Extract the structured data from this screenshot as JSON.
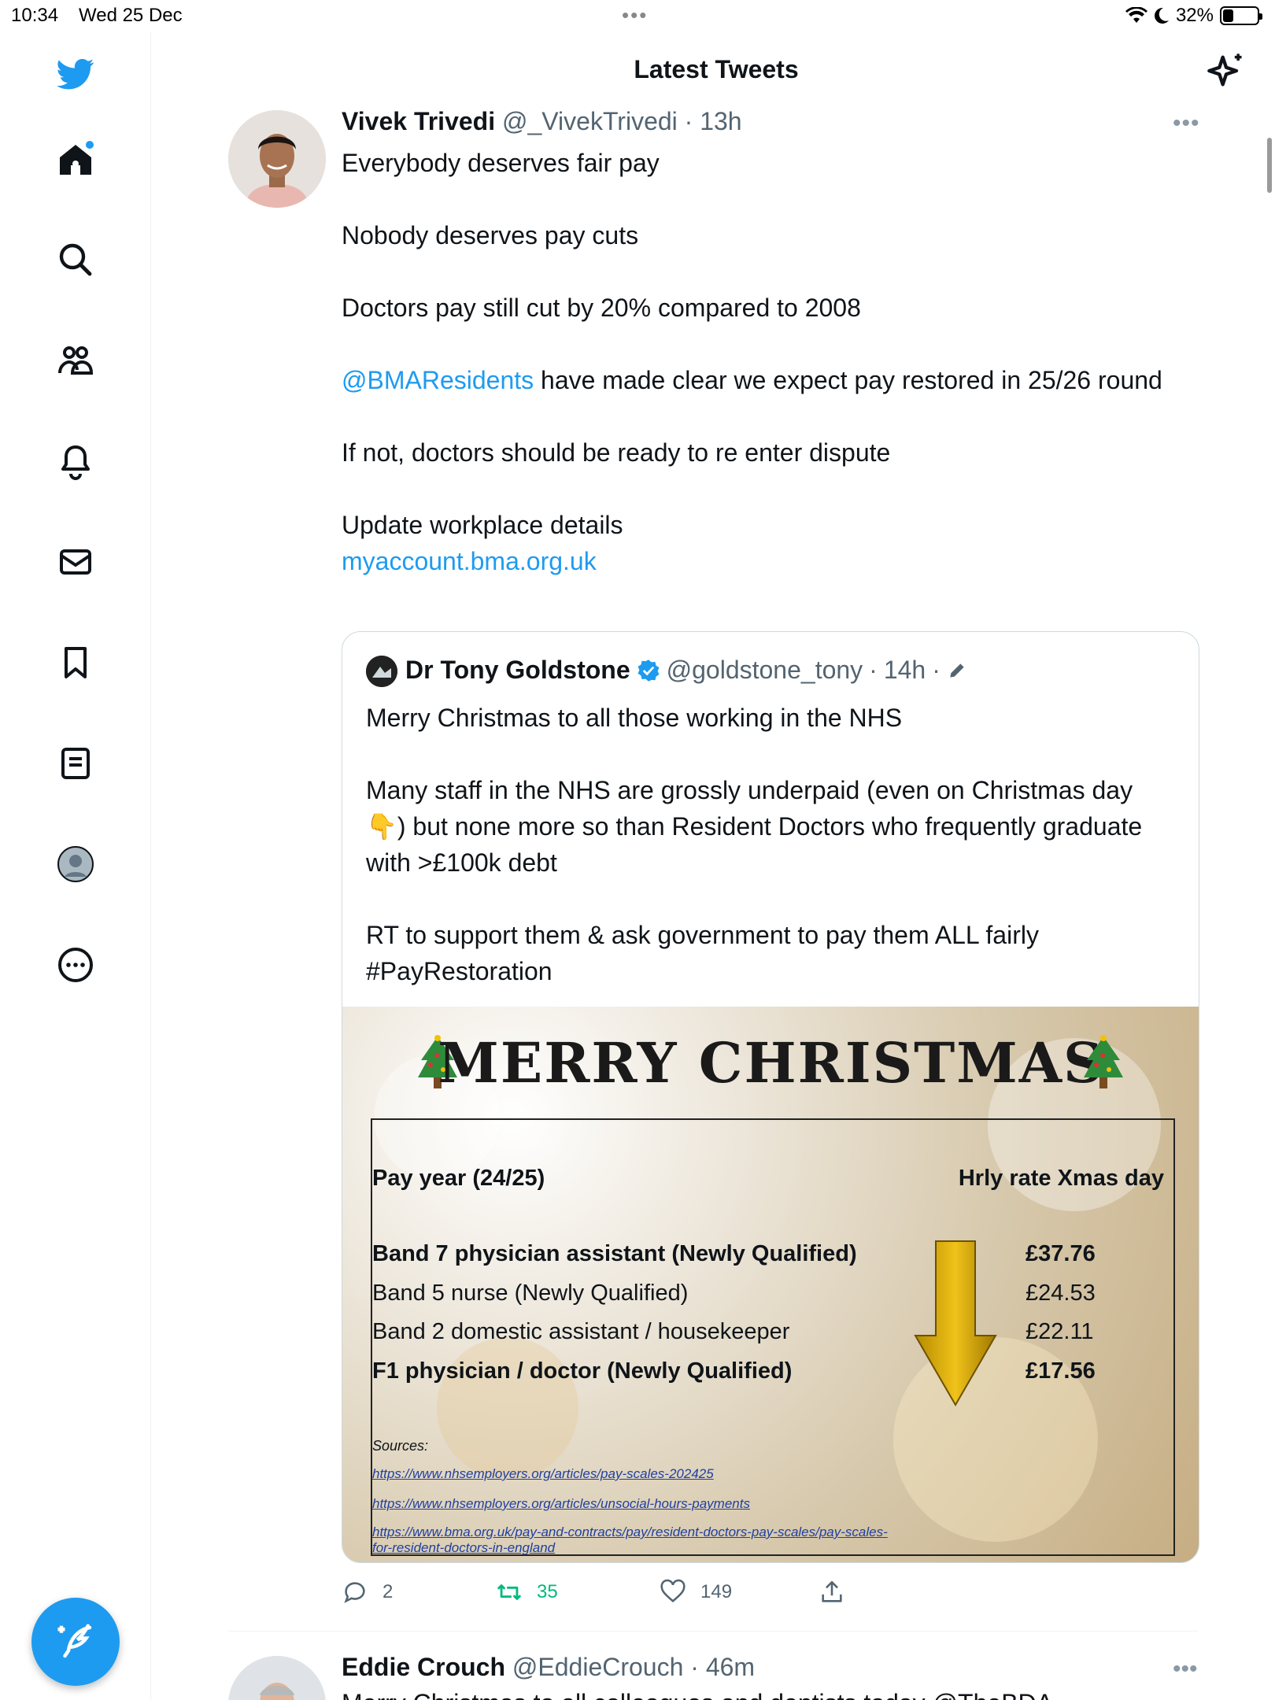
{
  "status_bar": {
    "time": "10:34",
    "date": "Wed 25 Dec",
    "battery": "32%",
    "battery_level": 0.32
  },
  "header": {
    "title": "Latest Tweets"
  },
  "tweet1": {
    "name": "Vivek Trivedi",
    "handle": "@_VivekTrivedi",
    "time": "13h",
    "line1": "Everybody deserves fair pay",
    "line2": "Nobody deserves pay cuts",
    "line3": "Doctors pay still cut by 20% compared to 2008",
    "mention": "@BMAResidents",
    "line4_rest": " have made clear we expect pay restored in 25/26 round",
    "line5": "If not, doctors should be ready to re enter dispute",
    "line6": "Update workplace details",
    "link": "myaccount.bma.org.uk",
    "quote": {
      "name": "Dr Tony Goldstone",
      "handle": "@goldstone_tony",
      "time": "14h",
      "line1": "Merry Christmas to all those working in the NHS",
      "line2a": "Many staff in the NHS are grossly underpaid (even on Christmas day ",
      "emoji": "👇",
      "line2b": ") but none more so than Resident Doctors who frequently graduate with >£100k debt",
      "line3": "RT to support them & ask government to pay them ALL fairly",
      "hashtag": "#PayRestoration",
      "image": {
        "title": "MERRY CHRISTMAS",
        "col_left": "Pay year (24/25)",
        "col_right": "Hrly rate Xmas day",
        "rows": [
          {
            "label": "Band 7 physician assistant (Newly Qualified)",
            "value": "£37.76"
          },
          {
            "label": "Band 5 nurse (Newly Qualified)",
            "value": "£24.53"
          },
          {
            "label": "Band 2 domestic assistant / housekeeper",
            "value": "£22.11"
          },
          {
            "label": "F1 physician / doctor (Newly Qualified)",
            "value": "£17.56"
          }
        ],
        "sources_label": "Sources:",
        "sources": [
          "https://www.nhsemployers.org/articles/pay-scales-202425",
          "https://www.nhsemployers.org/articles/unsocial-hours-payments",
          "https://www.bma.org.uk/pay-and-contracts/pay/resident-doctors-pay-scales/pay-scales-",
          "for-resident-doctors-in-england"
        ]
      }
    },
    "actions": {
      "replies": "2",
      "retweets": "35",
      "likes": "149"
    }
  },
  "tweet2": {
    "name": "Eddie Crouch",
    "handle": "@EddieCrouch",
    "time": "46m",
    "text_partial": "Merry Christmas to all colleagues and dentists today @TheBDA"
  }
}
